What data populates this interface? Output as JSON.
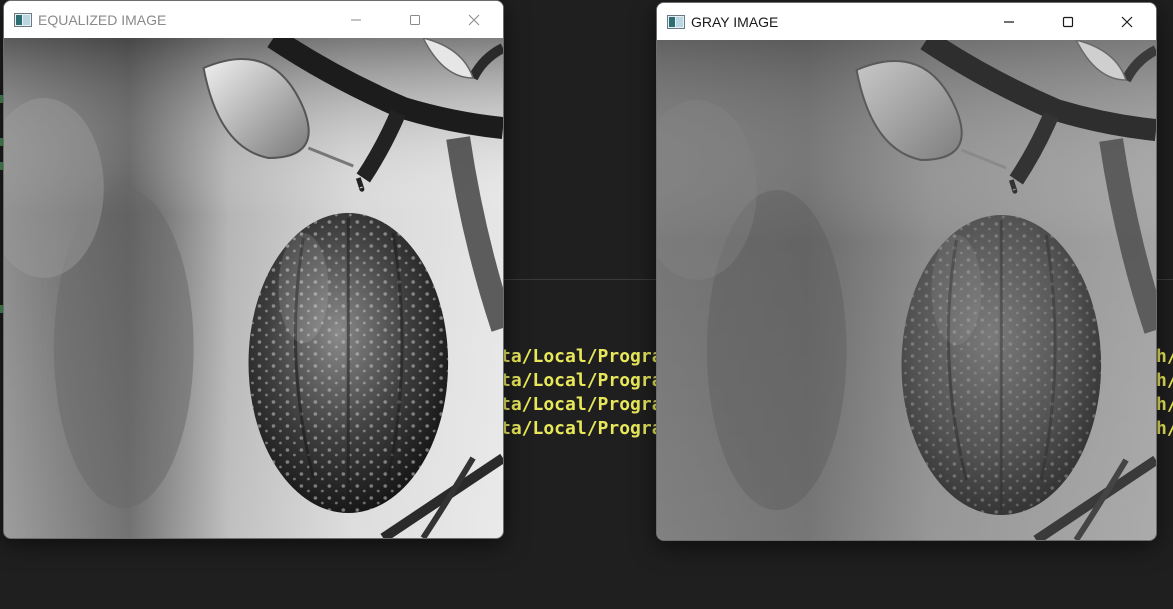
{
  "terminal": {
    "lines": [
      "ta/Local/Progra",
      "ta/Local/Progra",
      "ta/Local/Progra",
      "ta/Local/Progra"
    ],
    "right_lines": [
      "h/",
      "h/",
      "h/",
      "h/"
    ],
    "text_color": "#e8e85a"
  },
  "windows": [
    {
      "title": "EQUALIZED IMAGE",
      "active": false,
      "image": "apple-on-branch-equalized"
    },
    {
      "title": "GRAY IMAGE",
      "active": true,
      "image": "apple-on-branch-grayscale"
    }
  ],
  "caption_buttons": [
    "minimize-icon",
    "maximize-icon",
    "close-icon"
  ]
}
